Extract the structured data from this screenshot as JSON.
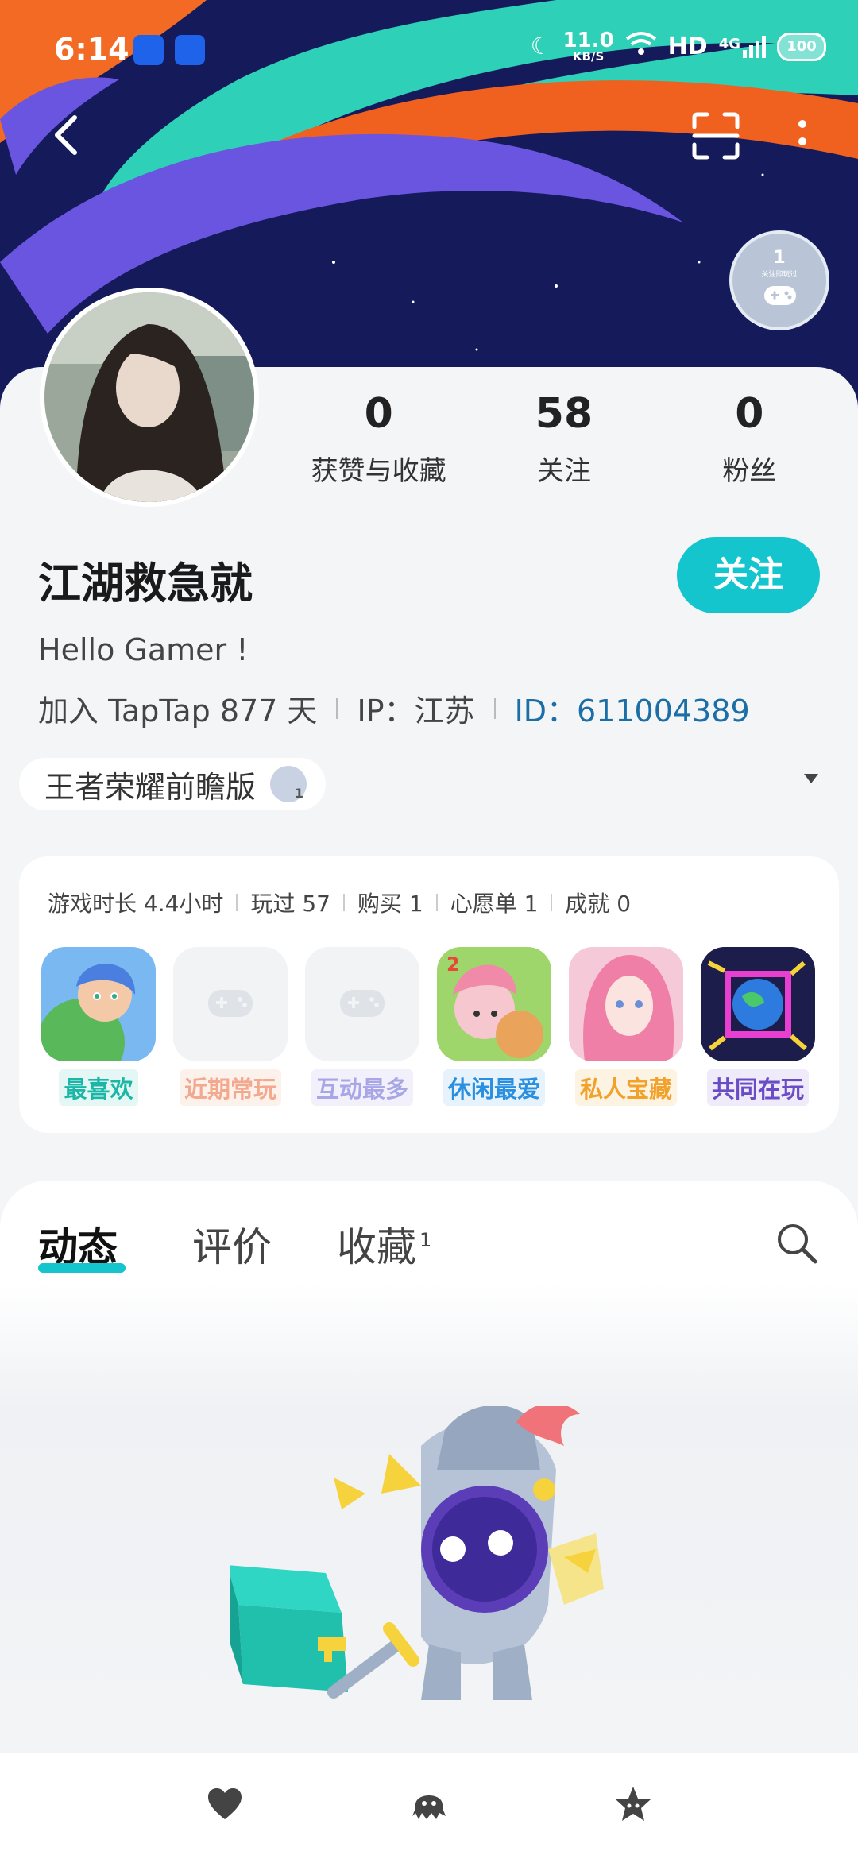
{
  "status_bar": {
    "time": "6:14",
    "net_speed": "11.0",
    "net_unit": "KB/S",
    "hd": "HD",
    "network": "4G",
    "battery": "100"
  },
  "icons": {
    "back": "back-arrow-icon",
    "scan": "scan-icon",
    "more": "more-vertical-icon",
    "search": "search-icon"
  },
  "achievement_badge": {
    "count": "1",
    "caption": "关注即玩过"
  },
  "stats": [
    {
      "value": "0",
      "label": "获赞与收藏"
    },
    {
      "value": "58",
      "label": "关注"
    },
    {
      "value": "0",
      "label": "粉丝"
    }
  ],
  "profile": {
    "name": "江湖救急就",
    "follow_label": "关注",
    "bio": "Hello Gamer !",
    "joined": "加入 TapTap 877 天",
    "ip": "IP：江苏",
    "id": "ID：611004389"
  },
  "game_tag": {
    "label": "王者荣耀前瞻版"
  },
  "game_stats": [
    "游戏时长 4.4小时",
    "玩过 57",
    "购买 1",
    "心愿单 1",
    "成就 0"
  ],
  "game_items": [
    {
      "label": "最喜欢",
      "color": "#1ab7a6"
    },
    {
      "label": "近期常玩",
      "color": "#f2a98e"
    },
    {
      "label": "互动最多",
      "color": "#a8a6e6"
    },
    {
      "label": "休闲最爱",
      "color": "#2b8fe0"
    },
    {
      "label": "私人宝藏",
      "color": "#f2a12a"
    },
    {
      "label": "共同在玩",
      "color": "#6a4cc4"
    }
  ],
  "tabs": [
    {
      "label": "动态"
    },
    {
      "label": "评价"
    },
    {
      "label": "收藏",
      "count": "1"
    }
  ],
  "colors": {
    "accent": "#15c5ce",
    "id_link": "#1b6ea6"
  }
}
